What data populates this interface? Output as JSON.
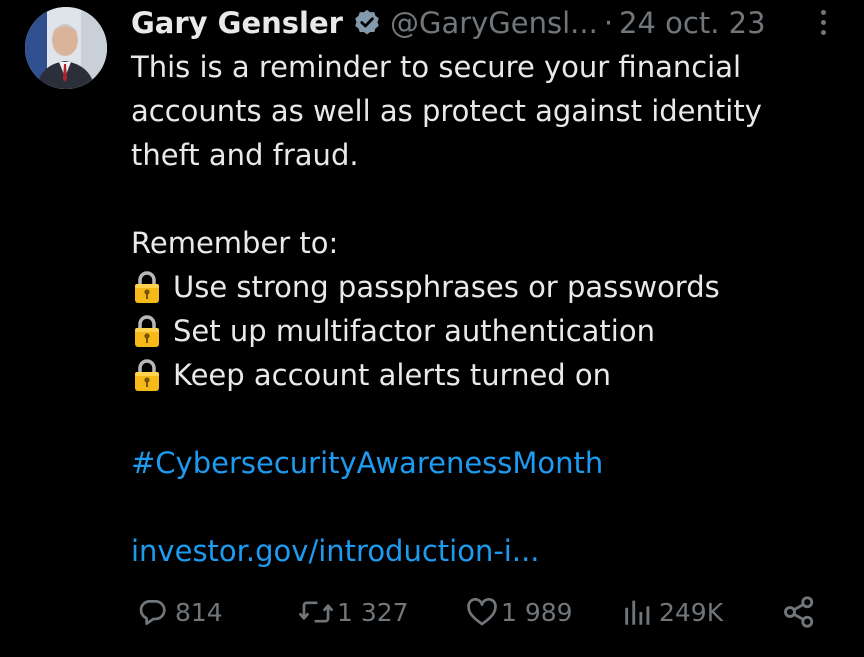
{
  "author": {
    "name": "Gary Gensler",
    "handle": "@GaryGensl...",
    "separator": "·",
    "date": "24 oct. 23"
  },
  "tweet": {
    "line1": "This is a reminder to secure your financial",
    "line2": "accounts as well as protect against identity",
    "line3": "theft and fraud.",
    "remember": "Remember to:",
    "tips": [
      "Use strong passphrases or passwords",
      "Set up multifactor authentication",
      "Keep account alerts turned on"
    ],
    "hashtag": "#CybersecurityAwarenessMonth",
    "link": "investor.gov/introduction-i..."
  },
  "actions": {
    "replies": "814",
    "reposts": "1 327",
    "likes": "1 989",
    "views": "249K"
  },
  "icons": {
    "verified": "verified-badge-icon",
    "more": "more-options-icon",
    "lock": "lock-emoji",
    "reply": "reply-icon",
    "repost": "repost-icon",
    "like": "like-icon",
    "views": "views-icon",
    "share": "share-icon"
  },
  "colors": {
    "background": "#000000",
    "text": "#e7e9ea",
    "secondary": "#71767b",
    "link": "#1d9bf0"
  }
}
